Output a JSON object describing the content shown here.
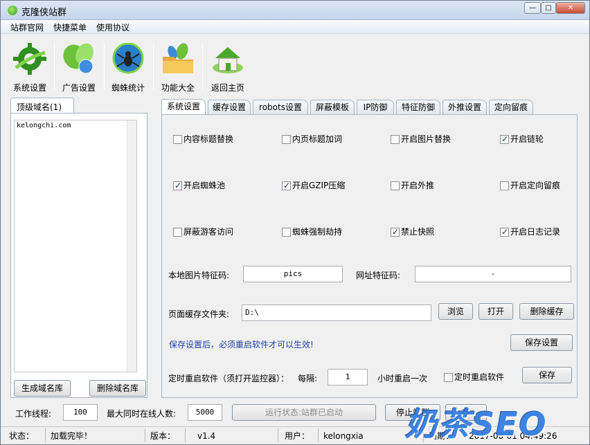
{
  "window": {
    "title": "克隆侠站群"
  },
  "menu": [
    "站群官网",
    "快捷菜单",
    "使用协议"
  ],
  "toolbar": [
    {
      "label": "系统设置",
      "icon": "gear-icon"
    },
    {
      "label": "广告设置",
      "icon": "globe-leaf-icon"
    },
    {
      "label": "蜘蛛统计",
      "icon": "spider-icon"
    },
    {
      "label": "功能大全",
      "icon": "folder-icon"
    },
    {
      "label": "返回主页",
      "icon": "home-icon"
    }
  ],
  "left": {
    "tab": "顶级域名(1)",
    "domains": [
      "kelongchi.com"
    ],
    "generate_button": "生成域名库",
    "delete_button": "删除域名库"
  },
  "tabs": [
    "系统设置",
    "缓存设置",
    "robots设置",
    "屏蔽模板",
    "IP防御",
    "特征防御",
    "外推设置",
    "定向留痕"
  ],
  "options": [
    {
      "label": "内容标题替换",
      "checked": false
    },
    {
      "label": "内页标题加词",
      "checked": false
    },
    {
      "label": "开启图片替换",
      "checked": false
    },
    {
      "label": "开启链轮",
      "checked": true
    },
    {
      "label": "开启蜘蛛池",
      "checked": true
    },
    {
      "label": "开启GZIP压缩",
      "checked": true
    },
    {
      "label": "开启外推",
      "checked": false
    },
    {
      "label": "开启定向留痕",
      "checked": false
    },
    {
      "label": "屏蔽游客访问",
      "checked": false
    },
    {
      "label": "蜘蛛强制劫持",
      "checked": false
    },
    {
      "label": "禁止快照",
      "checked": true
    },
    {
      "label": "开启日志记录",
      "checked": true
    }
  ],
  "fields": {
    "img_code_label": "本地图片特征码:",
    "img_code_value": "pics",
    "url_code_label": "网址特征码:",
    "url_code_value": "-",
    "cache_label": "页面缓存文件夹:",
    "cache_value": "D:\\",
    "browse": "浏览",
    "open": "打开",
    "delete_cache": "删除缓存",
    "notice": "保存设置后，必须重启软件才可以生效!",
    "save_settings": "保存设置",
    "restart_label": "定时重启软件（须打开监控器）：",
    "every_label": "每隔:",
    "every_value": "1",
    "hours_label": "小时重启一次",
    "restart_check_label": "定时重启软件",
    "restart_checked": false,
    "save": "保存"
  },
  "bottom": {
    "threads_label": "工作线程:",
    "threads_value": "100",
    "max_users_label": "最大同时在线人数:",
    "max_users_value": "5000",
    "run_status": "运行状态:站群已启动",
    "stop_button": "停止站群",
    "partial_button": "在"
  },
  "status": {
    "state_label": "状态：",
    "state_value": "加载完毕！",
    "version_label": "版本：",
    "version_value": "v1.4",
    "user_label": "用户：",
    "user_value": "kelongxia",
    "expire_label": "到期：",
    "expire_value": "2017-08-01 04:49:26"
  },
  "watermark": "奶茶SEO"
}
